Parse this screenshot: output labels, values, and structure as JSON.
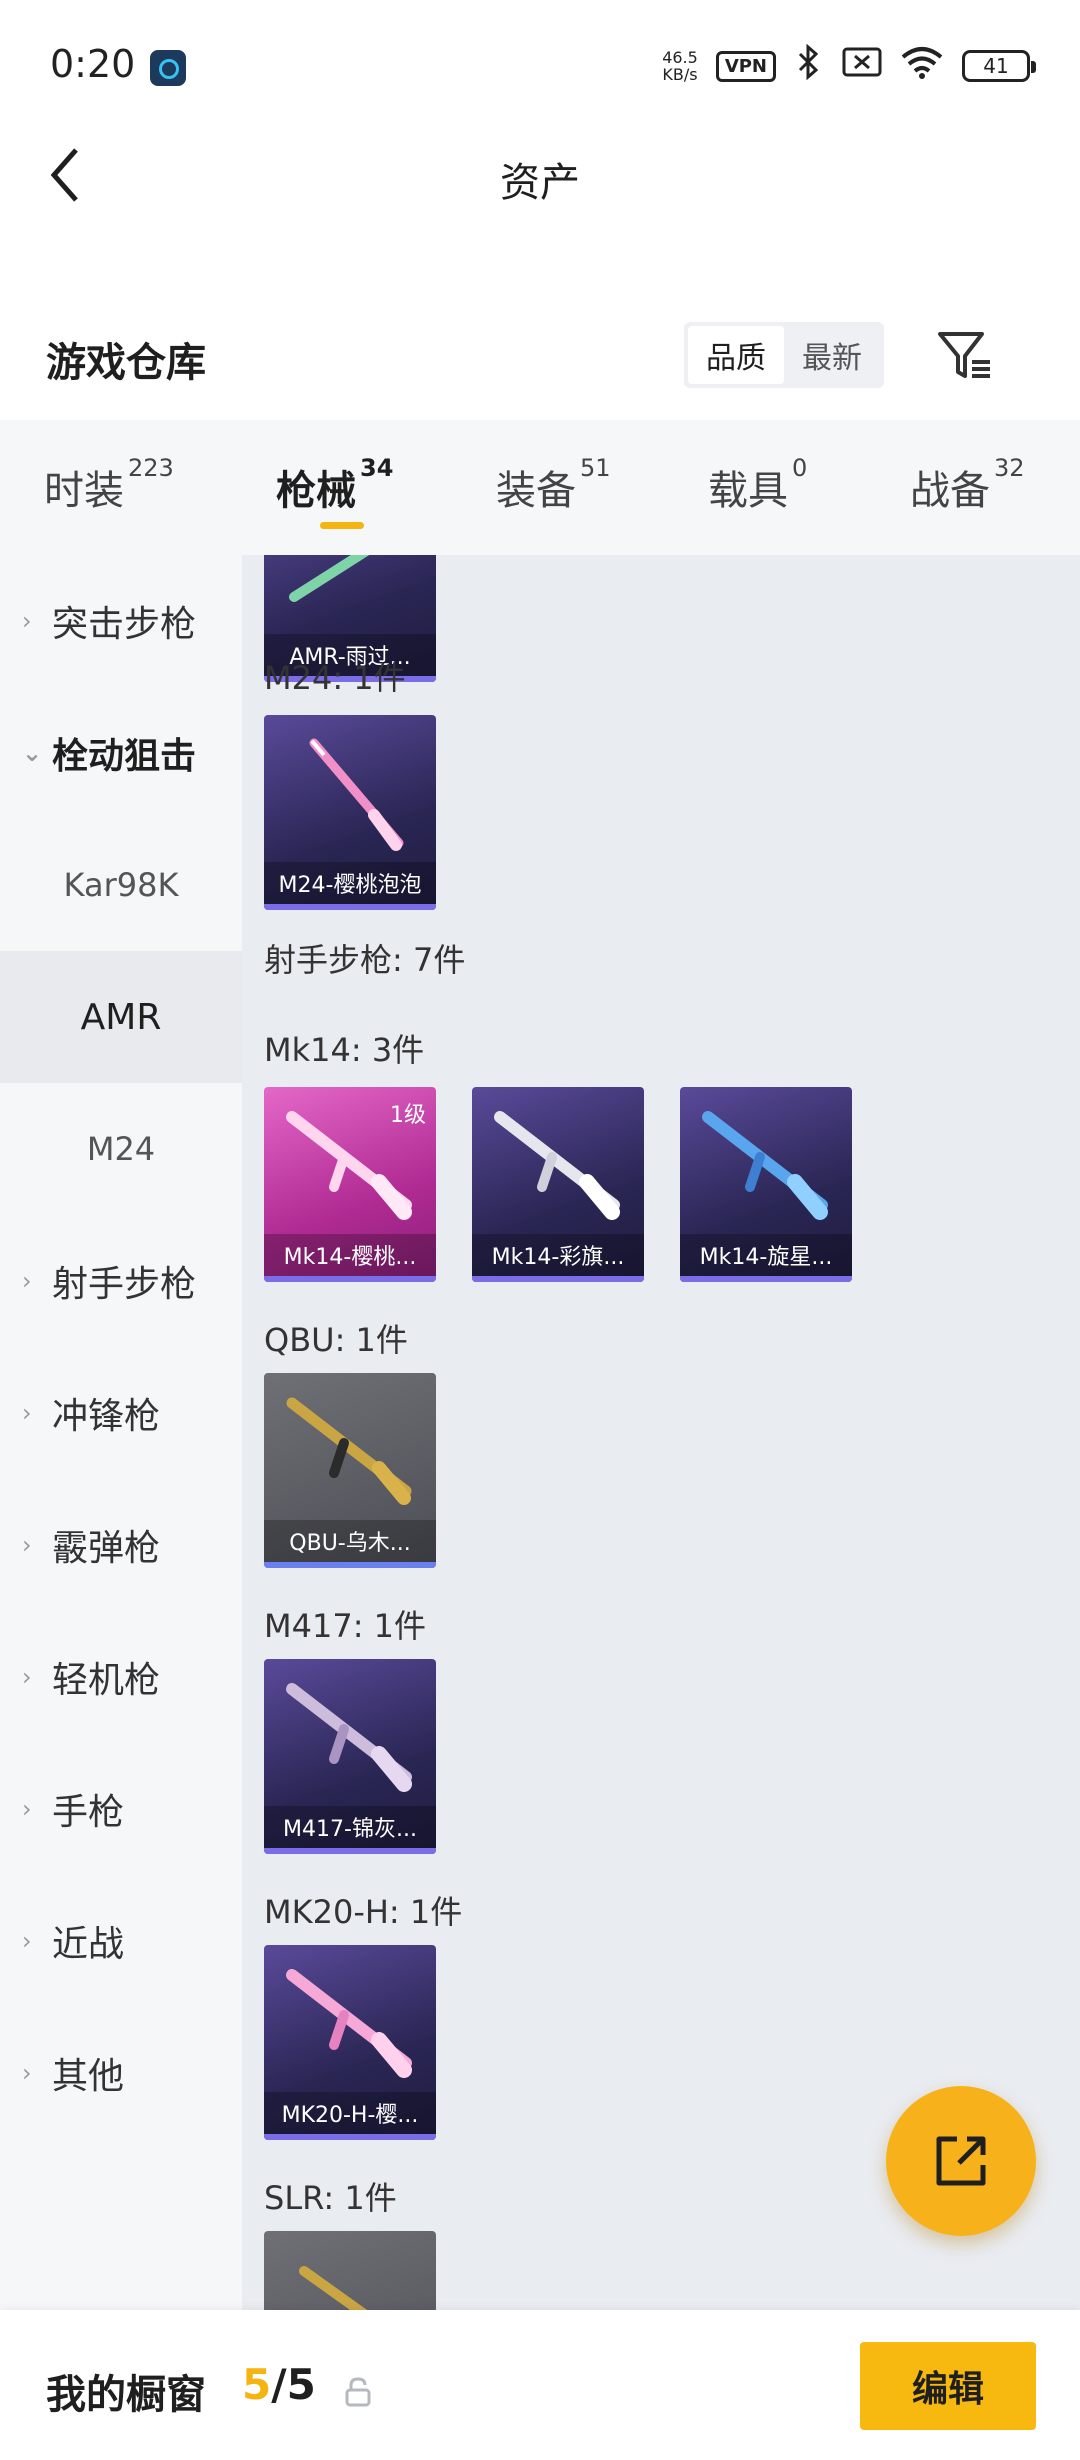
{
  "status_bar": {
    "time": "0:20",
    "net_speed_value": "46.5",
    "net_speed_unit": "KB/s",
    "vpn": "VPN",
    "battery": "41"
  },
  "header": {
    "title": "资产"
  },
  "section": {
    "title": "游戏仓库",
    "sort_options": [
      "品质",
      "最新"
    ],
    "active_sort": "品质"
  },
  "tabs": [
    {
      "label": "时装",
      "count": "223"
    },
    {
      "label": "枪械",
      "count": "34"
    },
    {
      "label": "装备",
      "count": "51"
    },
    {
      "label": "载具",
      "count": "0"
    },
    {
      "label": "战备",
      "count": "32"
    }
  ],
  "active_tab": "枪械",
  "sidebar": {
    "items": [
      {
        "label": "突击步枪"
      },
      {
        "label": "栓动狙击"
      },
      {
        "label": "Kar98K"
      },
      {
        "label": "AMR"
      },
      {
        "label": "M24"
      },
      {
        "label": "射手步枪"
      },
      {
        "label": "冲锋枪"
      },
      {
        "label": "霰弹枪"
      },
      {
        "label": "轻机枪"
      },
      {
        "label": "手枪"
      },
      {
        "label": "近战"
      },
      {
        "label": "其他"
      }
    ],
    "selected": "AMR"
  },
  "content": {
    "groups": [
      {
        "label": "M24: 1件"
      },
      {
        "label": "射手步枪: 7件"
      },
      {
        "label": "Mk14: 3件"
      },
      {
        "label": "QBU: 1件"
      },
      {
        "label": "M417: 1件"
      },
      {
        "label": "MK20-H: 1件"
      },
      {
        "label": "SLR: 1件"
      }
    ],
    "items": [
      {
        "name": "AMR-雨过...",
        "rarity": "purple"
      },
      {
        "name": "M24-樱桃泡泡",
        "rarity": "purple"
      },
      {
        "name": "Mk14-樱桃...",
        "rarity": "pink",
        "level": "1级"
      },
      {
        "name": "Mk14-彩旗...",
        "rarity": "purple"
      },
      {
        "name": "Mk14-旋星...",
        "rarity": "purple"
      },
      {
        "name": "QBU-乌木...",
        "rarity": "grey"
      },
      {
        "name": "M417-锦灰...",
        "rarity": "purple"
      },
      {
        "name": "MK20-H-樱...",
        "rarity": "purple"
      }
    ]
  },
  "bottom_bar": {
    "label": "我的橱窗",
    "current": "5",
    "separator": "/",
    "max": "5",
    "edit": "编辑"
  },
  "colors": {
    "accent": "#f5b40f",
    "content_bg": "#e9ecf1",
    "sidebar_bg": "#f6f7f9"
  }
}
